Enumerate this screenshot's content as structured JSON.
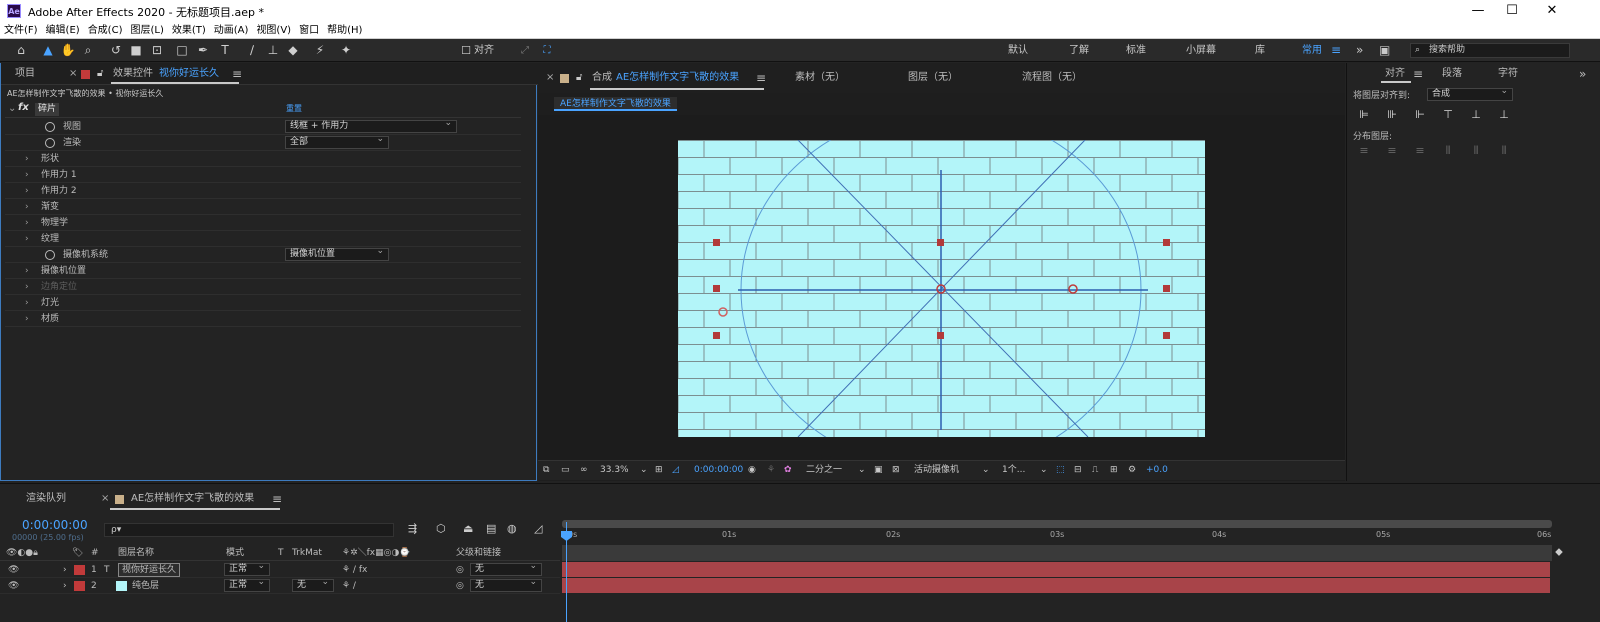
{
  "window": {
    "title": "Adobe After Effects 2020 - 无标题项目.aep *",
    "logo": "Ae",
    "min": "—",
    "max": "☐",
    "close": "✕"
  },
  "menu": [
    "文件(F)",
    "编辑(E)",
    "合成(C)",
    "图层(L)",
    "效果(T)",
    "动画(A)",
    "视图(V)",
    "窗口",
    "帮助(H)"
  ],
  "toolbar": {
    "align_label": "对齐",
    "workspaces": [
      "默认",
      "了解",
      "标准",
      "小屏幕",
      "库",
      "常用"
    ],
    "active_workspace": "常用",
    "search_placeholder": "搜索帮助"
  },
  "left_panel": {
    "tab_project": "项目",
    "tab_effects_prefix": "效果控件",
    "tab_effects_layer": "视你好运长久",
    "breadcrumb": "AE怎样制作文字飞散的效果 • 视你好运长久",
    "fx_name": "碎片",
    "reset": "重置",
    "rows": [
      {
        "label": "视图",
        "value": "线框 + 作用力",
        "stopwatch": true
      },
      {
        "label": "渲染",
        "value": "全部",
        "stopwatch": true
      },
      {
        "label": "形状",
        "arrow": true
      },
      {
        "label": "作用力 1",
        "arrow": true
      },
      {
        "label": "作用力 2",
        "arrow": true
      },
      {
        "label": "渐变",
        "arrow": true
      },
      {
        "label": "物理学",
        "arrow": true
      },
      {
        "label": "纹理",
        "arrow": true
      },
      {
        "label": "摄像机系统",
        "value": "摄像机位置",
        "stopwatch": true
      },
      {
        "label": "摄像机位置",
        "arrow": true
      },
      {
        "label": "边角定位",
        "arrow": true,
        "dim": true
      },
      {
        "label": "灯光",
        "arrow": true
      },
      {
        "label": "材质",
        "arrow": true
      }
    ]
  },
  "comp_panel": {
    "tab_comp_prefix": "合成",
    "tab_comp_name": "AE怎样制作文字飞散的效果",
    "tab_footage": "素材（无）",
    "tab_layer": "图层（无）",
    "tab_flow": "流程图（无）",
    "subtab": "AE怎样制作文字飞散的效果",
    "zoom": "33.3%",
    "timecode": "0:00:00:00",
    "resolution": "二分之一",
    "camera": "活动摄像机",
    "views": "1个...",
    "exposure": "+0.0",
    "canvas_color": "#b3f5f9"
  },
  "right_panel": {
    "tabs": [
      "对齐",
      "段落",
      "字符"
    ],
    "active_tab": "对齐",
    "align_to_label": "将图层对齐到:",
    "align_to_value": "合成",
    "distribute_label": "分布图层:"
  },
  "timeline": {
    "tab_render": "渲染队列",
    "tab_comp": "AE怎样制作文字飞散的效果",
    "timecode": "0:00:00:00",
    "timecode_sub": "00000 (25.00 fps)",
    "search_placeholder": "ρ▾",
    "headers": {
      "name": "图层名称",
      "mode": "模式",
      "t": "T",
      "trkmat": "TrkMat",
      "parent": "父级和链接"
    },
    "layers": [
      {
        "num": "1",
        "type": "T",
        "name": "视你好运长久",
        "mode": "正常",
        "trkmat": "",
        "parent": "无",
        "color": "#c13a3a"
      },
      {
        "num": "2",
        "type": "■",
        "name": "纯色层",
        "mode": "正常",
        "trkmat": "无",
        "parent": "无",
        "color": "#c13a3a"
      }
    ],
    "ruler": [
      "0s",
      "01s",
      "02s",
      "03s",
      "04s",
      "05s",
      "06s"
    ]
  }
}
